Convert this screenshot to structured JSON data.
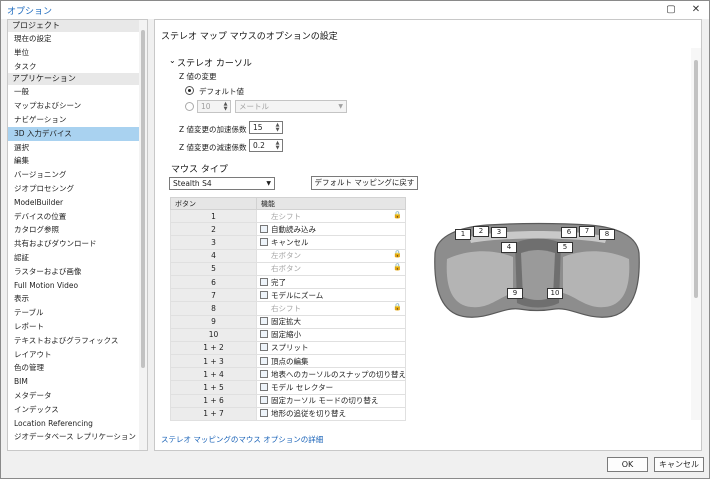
{
  "window": {
    "title": "オプション",
    "minimize_glyph": "▢",
    "close_glyph": "✕"
  },
  "sidebar": {
    "sections": [
      {
        "label": "プロジェクト",
        "items": [
          {
            "label": "現在の設定"
          },
          {
            "label": "単位"
          },
          {
            "label": "タスク"
          }
        ]
      },
      {
        "label": "アプリケーション",
        "items": [
          {
            "label": "一般"
          },
          {
            "label": "マップおよびシーン"
          },
          {
            "label": "ナビゲーション"
          },
          {
            "label": "3D 入力デバイス",
            "active": true
          },
          {
            "label": "選択"
          },
          {
            "label": "編集"
          },
          {
            "label": "バージョニング"
          },
          {
            "label": "ジオプロセシング"
          },
          {
            "label": "ModelBuilder"
          },
          {
            "label": "デバイスの位置"
          },
          {
            "label": "カタログ参照"
          },
          {
            "label": "共有およびダウンロード"
          },
          {
            "label": "認証"
          },
          {
            "label": "ラスターおよび画像"
          },
          {
            "label": "Full Motion Video"
          },
          {
            "label": "表示"
          },
          {
            "label": "テーブル"
          },
          {
            "label": "レポート"
          },
          {
            "label": "テキストおよびグラフィックス"
          },
          {
            "label": "レイアウト"
          },
          {
            "label": "色の管理"
          },
          {
            "label": "BIM"
          },
          {
            "label": "メタデータ"
          },
          {
            "label": "インデックス"
          },
          {
            "label": "Location Referencing"
          },
          {
            "label": "ジオデータベース レプリケーション"
          }
        ]
      }
    ]
  },
  "main": {
    "title": "ステレオ マップ マウスのオプションの設定",
    "stereo_cursor": {
      "header": "ステレオ カーソル",
      "chevron_glyph": "⌄",
      "z_change_label": "Z 値の変更",
      "default_radio_label": "デフォルト値",
      "custom_value": "10",
      "unit_value": "メートル",
      "accel_label": "Z 値変更の加速係数",
      "accel_value": "15",
      "decel_label": "Z 値変更の減速係数",
      "decel_value": "0.2"
    },
    "mouse_type": {
      "header": "マウス タイプ",
      "selected": "Stealth S4",
      "reset_button": "デフォルト マッピングに戻す"
    },
    "table": {
      "headers": {
        "button": "ボタン",
        "function": "機能"
      },
      "rows": [
        {
          "button": "1",
          "function": "左シフト",
          "locked": true,
          "disabled": true,
          "icon": ""
        },
        {
          "button": "2",
          "function": "自動読み込み",
          "icon": "auto-load-icon"
        },
        {
          "button": "3",
          "function": "キャンセル",
          "icon": "cancel-icon"
        },
        {
          "button": "4",
          "function": "左ボタン",
          "locked": true,
          "disabled": true,
          "icon": ""
        },
        {
          "button": "5",
          "function": "右ボタン",
          "locked": true,
          "disabled": true,
          "icon": ""
        },
        {
          "button": "6",
          "function": "完了",
          "icon": "finish-icon"
        },
        {
          "button": "7",
          "function": "モデルにズーム",
          "icon": "zoom-model-icon"
        },
        {
          "button": "8",
          "function": "右シフト",
          "locked": true,
          "disabled": true,
          "icon": ""
        },
        {
          "button": "9",
          "function": "固定拡大",
          "icon": "fixed-zoom-in-icon"
        },
        {
          "button": "10",
          "function": "固定縮小",
          "icon": "fixed-zoom-out-icon"
        },
        {
          "button": "1 + 2",
          "function": "スプリット",
          "icon": "split-icon"
        },
        {
          "button": "1 + 3",
          "function": "頂点の編集",
          "icon": "edit-vertices-icon"
        },
        {
          "button": "1 + 4",
          "function": "地表へのカーソルのスナップの切り替え",
          "icon": "snap-cursor-icon"
        },
        {
          "button": "1 + 5",
          "function": "モデル セレクター",
          "icon": "model-selector-icon"
        },
        {
          "button": "1 + 6",
          "function": "固定カーソル モードの切り替え",
          "icon": "fixed-cursor-icon"
        },
        {
          "button": "1 + 7",
          "function": "地形の追従を切り替え",
          "icon": "terrain-follow-icon"
        }
      ]
    },
    "mouse_buttons": [
      "1",
      "2",
      "3",
      "4",
      "5",
      "6",
      "7",
      "8",
      "9",
      "10"
    ],
    "lock_glyph": "🔒",
    "link": "ステレオ マッピングのマウス オプションの詳細"
  },
  "footer": {
    "ok": "OK",
    "cancel": "キャンセル"
  }
}
